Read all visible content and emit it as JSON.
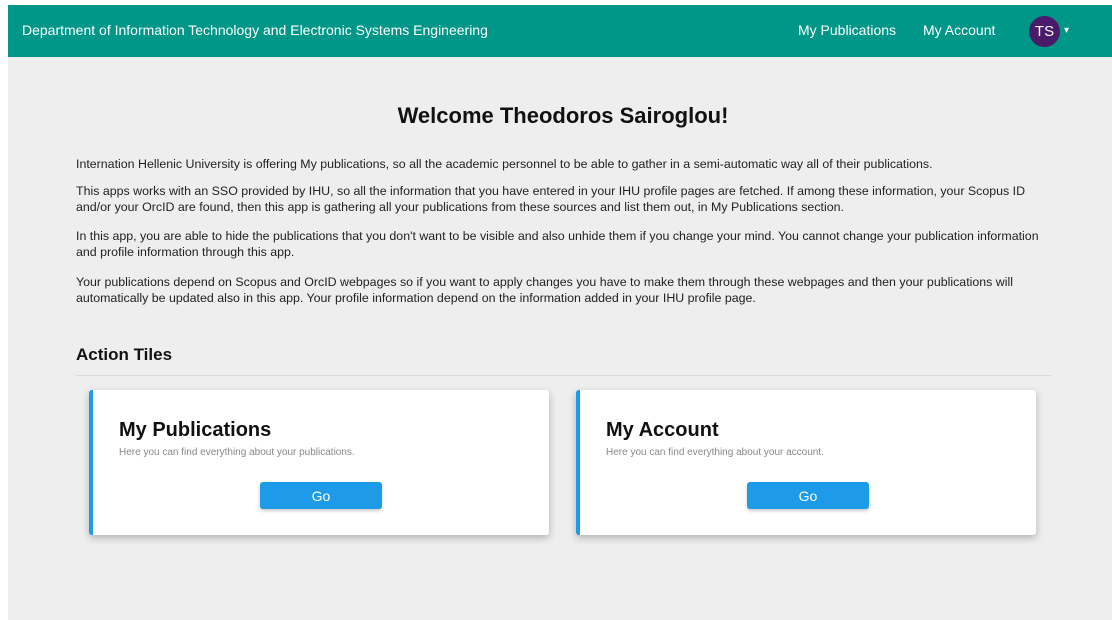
{
  "navbar": {
    "brand": "Department of Information Technology and Electronic Systems Engineering",
    "links": [
      "My Publications",
      "My Account"
    ],
    "avatar_initials": "TS",
    "caret": "▾",
    "color": "#009688"
  },
  "main": {
    "welcome": "Welcome Theodoros Sairoglou!",
    "paragraphs": [
      "Internation Hellenic University is offering My publications, so all the academic personnel to be able to gather in a semi-automatic way all of their publications.",
      "This apps works with an SSO provided by IHU, so all the information that you have entered in your IHU profile pages are fetched. If among these information, your Scopus ID and/or your OrcID are found, then this app is gathering all your publications from these sources and list them out, in My Publications section.",
      "In this app, you are able to hide the publications that you don't want to be visible and also unhide them if you change your mind. You cannot change your publication information and profile information through this app.",
      "Your publications depend on Scopus and OrcID webpages so if you want to apply changes you have to make them through these webpages and then your publications will automatically be updated also in this app. Your profile information depend on the information added in your IHU profile page."
    ],
    "section_title": "Action Tiles",
    "tiles": [
      {
        "title": "My Publications",
        "description": "Here you can find everything about your publications.",
        "button": "Go"
      },
      {
        "title": "My Account",
        "description": "Here you can find everything about your account.",
        "button": "Go"
      }
    ],
    "accent_color": "#1e9be8",
    "avatar_color": "#4a1a6b"
  }
}
